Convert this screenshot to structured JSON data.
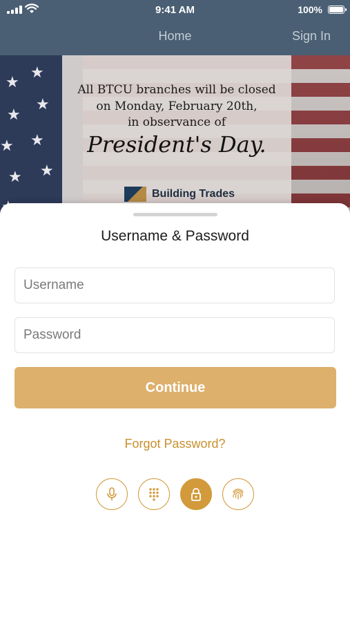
{
  "status": {
    "time": "9:41 AM",
    "battery": "100%",
    "icons": [
      "signal-icon",
      "wifi-icon",
      "battery-icon"
    ]
  },
  "nav": {
    "title": "Home",
    "sign_in": "Sign In"
  },
  "banner": {
    "line1": "All BTCU branches will be closed",
    "line2": "on Monday, February 20th,",
    "line3": "in observance of",
    "script": "President's Day.",
    "logo_text": "Building Trades"
  },
  "sheet": {
    "title": "Username & Password",
    "username_placeholder": "Username",
    "password_placeholder": "Password",
    "continue_label": "Continue",
    "forgot_label": "Forgot Password?",
    "auth_methods": [
      "microphone-icon",
      "keypad-icon",
      "lock-icon",
      "fingerprint-icon"
    ]
  },
  "colors": {
    "header": "#4a5f73",
    "accent": "#d29a3b",
    "button": "#ddb06c",
    "link": "#c88f2c"
  }
}
